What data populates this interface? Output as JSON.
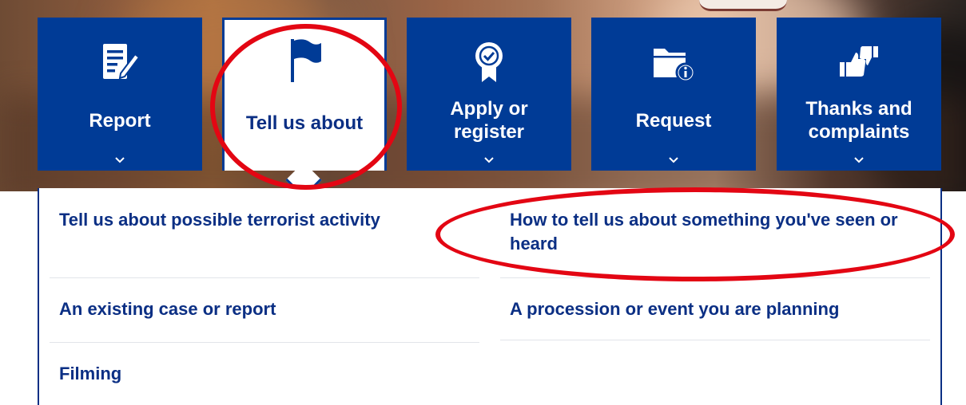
{
  "nav": {
    "tiles": [
      {
        "label": "Report",
        "icon": "report-form-icon"
      },
      {
        "label": "Tell us about",
        "icon": "flag-icon"
      },
      {
        "label": "Apply or register",
        "icon": "award-rosette-icon"
      },
      {
        "label": "Request",
        "icon": "folder-info-icon"
      },
      {
        "label": "Thanks and complaints",
        "icon": "thumbs-up-down-icon"
      }
    ],
    "active_index": 1
  },
  "dropdown": {
    "links": [
      "Tell us about possible terrorist activity",
      "How to tell us about something you've seen or heard",
      "An existing case or report",
      "A procession or event you are planning",
      "Filming"
    ]
  },
  "colors": {
    "brand_blue": "#003b96",
    "link_blue": "#0b2f84",
    "annotation_red": "#e30613"
  }
}
